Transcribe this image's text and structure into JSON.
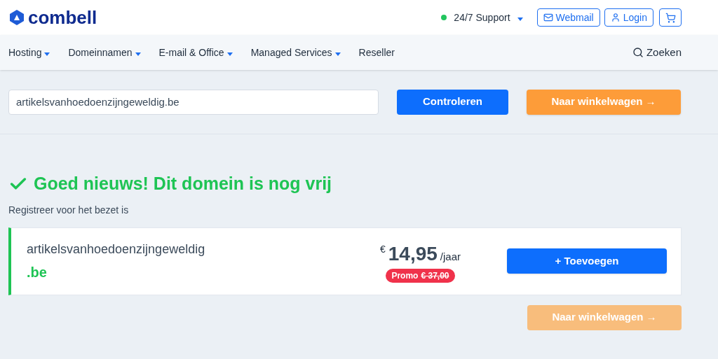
{
  "logo": {
    "text": "combell"
  },
  "topbar": {
    "support": {
      "label": "24/7 Support",
      "online": true
    },
    "webmail": "Webmail",
    "login": "Login"
  },
  "nav": {
    "items": [
      {
        "label": "Hosting",
        "dropdown": true
      },
      {
        "label": "Domeinnamen",
        "dropdown": true
      },
      {
        "label": "E-mail & Office",
        "dropdown": true
      },
      {
        "label": "Managed Services",
        "dropdown": true
      },
      {
        "label": "Reseller",
        "dropdown": false
      }
    ],
    "search": "Zoeken"
  },
  "domain_search": {
    "value": "artikelsvanhoedoenzijngeweldig.be",
    "check_button": "Controleren",
    "cart_button": {
      "label": "Naar winkelwagen →",
      "disabled": false
    }
  },
  "result": {
    "title": "Goed nieuws! Dit domein is nog vrij",
    "subtitle": "Registreer voor het bezet is",
    "domain": {
      "name": "artikelsvanhoedoenzijngeweldig",
      "tld": ".be",
      "currency": "€",
      "price": "14,95",
      "period": "/jaar",
      "promo_label": "Promo",
      "old_price": "€ 37,00",
      "add_button": "+ Toevoegen"
    },
    "cart_button": {
      "label": "Naar winkelwagen →",
      "disabled": true
    }
  }
}
